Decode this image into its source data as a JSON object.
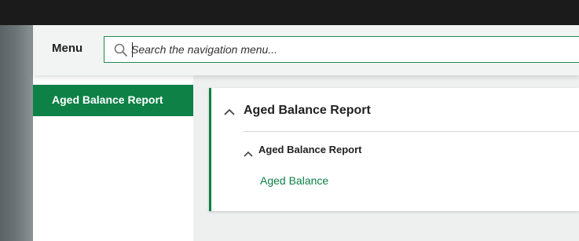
{
  "nav": {
    "menu_label": "Menu",
    "search_placeholder": "Search the navigation menu...",
    "search_value": ""
  },
  "sidebar": {
    "items": [
      {
        "label": "Aged Balance Report",
        "active": true
      }
    ]
  },
  "content": {
    "section_title": "Aged Balance Report",
    "subsection_title": "Aged Balance Report",
    "links": [
      {
        "label": "Aged Balance"
      }
    ]
  },
  "colors": {
    "accent": "#0d8146",
    "topbar": "#1b1b1b"
  }
}
